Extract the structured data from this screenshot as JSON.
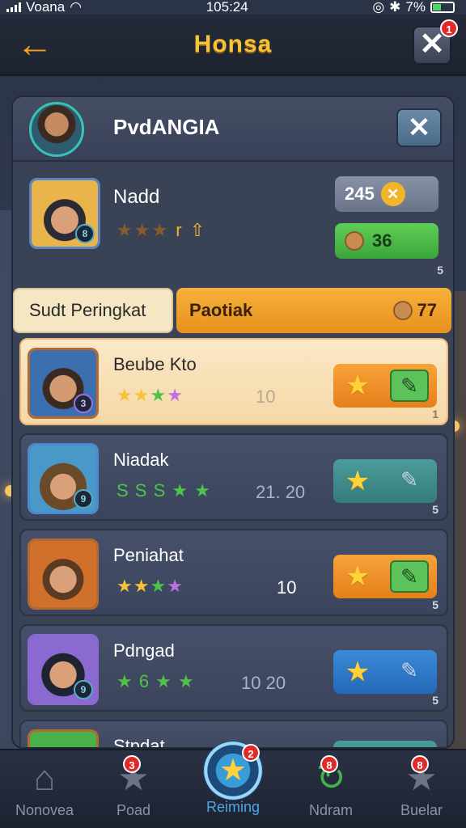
{
  "status": {
    "carrier": "Voana",
    "time": "105:24",
    "battery": "7%"
  },
  "header": {
    "title": "Honsa",
    "back_icon": "arrow-left-icon",
    "close_badge": "1"
  },
  "panel": {
    "title": "PvdANGIA"
  },
  "profile": {
    "name": "Nadd",
    "stars": "★★★",
    "rank_glyph": "r",
    "level": "8",
    "coins": "245",
    "gems": "36",
    "corner": "5"
  },
  "tabs": {
    "ranking": "Sudt Peringkat",
    "points": "Paotiak",
    "points_value": "77"
  },
  "rows": [
    {
      "name": "Beube Kto",
      "stars": [
        "y",
        "y",
        "g",
        "p"
      ],
      "score": "10",
      "level": "3",
      "corner": "1"
    },
    {
      "name": "Niadak",
      "stars_text": "S S S ★ ★",
      "score": "21. 20",
      "level": "9",
      "corner": "5"
    },
    {
      "name": "Peniahat",
      "stars": [
        "y",
        "y",
        "g",
        "p"
      ],
      "score": "10",
      "level": "",
      "corner": "5"
    },
    {
      "name": "Pdngad",
      "stars_text": "★ 6 ★ ★",
      "score": "10 20",
      "level": "9",
      "corner": "5"
    },
    {
      "name": "Stpdat"
    }
  ],
  "nav": {
    "home": "Nonovea",
    "home_badge": "",
    "road": "Poad",
    "road_badge": "3",
    "ranking": "Reiming",
    "ranking_badge": "2",
    "reward": "Ndram",
    "reward_badge": "8",
    "bear": "Buelar",
    "bear_badge": "8"
  },
  "colors": {
    "accent": "#f6c239",
    "orange": "#e8901e",
    "highlight": "#f5d8a6",
    "teal": "#357c7c",
    "blue": "#2468b8"
  }
}
